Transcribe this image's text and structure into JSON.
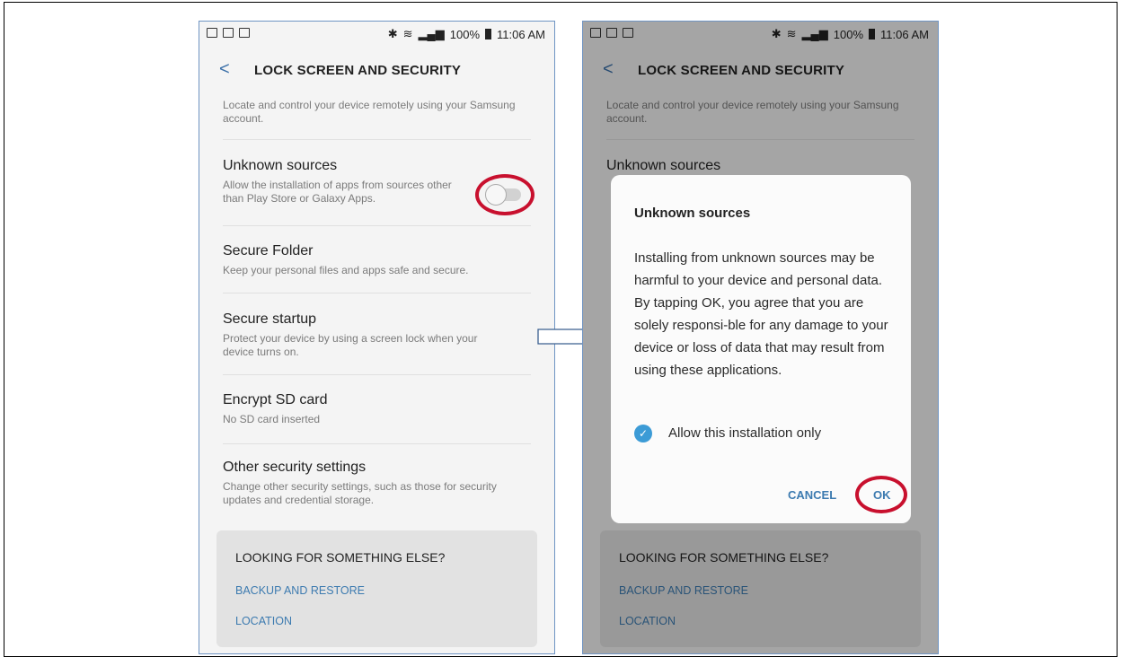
{
  "left_phone": {
    "status": {
      "battery": "100%",
      "time": "11:06 AM"
    },
    "header": {
      "back_glyph": "<",
      "title": "LOCK SCREEN AND SECURITY"
    },
    "top_text": "Locate and control your device remotely using your Samsung account.",
    "items": [
      {
        "title": "Unknown sources",
        "subtitle": "Allow the installation of apps from sources other than Play Store or Galaxy Apps."
      },
      {
        "title": "Secure Folder",
        "subtitle": "Keep your personal files and apps safe and secure."
      },
      {
        "title": "Secure startup",
        "subtitle": "Protect your device by using a screen lock when your device turns on."
      },
      {
        "title": "Encrypt SD card",
        "subtitle": "No SD card inserted"
      },
      {
        "title": "Other security settings",
        "subtitle": "Change other security settings, such as those for security updates and credential storage."
      }
    ],
    "toggle": {
      "state": "off"
    },
    "looking": {
      "title": "LOOKING FOR SOMETHING ELSE?",
      "links": [
        "BACKUP AND RESTORE",
        "LOCATION"
      ]
    }
  },
  "right_phone": {
    "status": {
      "battery": "100%",
      "time": "11:06 AM"
    },
    "header": {
      "back_glyph": "<",
      "title": "LOCK SCREEN AND SECURITY"
    },
    "top_text": "Locate and control your device remotely using your Samsung account.",
    "bg_item_title": "Unknown sources",
    "looking": {
      "title": "LOOKING FOR SOMETHING ELSE?",
      "links": [
        "BACKUP AND RESTORE",
        "LOCATION"
      ]
    },
    "dialog": {
      "title": "Unknown sources",
      "body": "Installing from unknown sources may be harmful to your device and personal data. By tapping OK, you agree that you are solely responsi-ble for any damage to your device or loss of data that may result from using these applications.",
      "checkbox_label": "Allow this installation only",
      "checkbox_checked": true,
      "cancel_label": "CANCEL",
      "ok_label": "OK"
    }
  },
  "colors": {
    "accent": "#3d7bb0",
    "highlight": "#c8102e",
    "arrow_border": "#3a5f8f"
  }
}
